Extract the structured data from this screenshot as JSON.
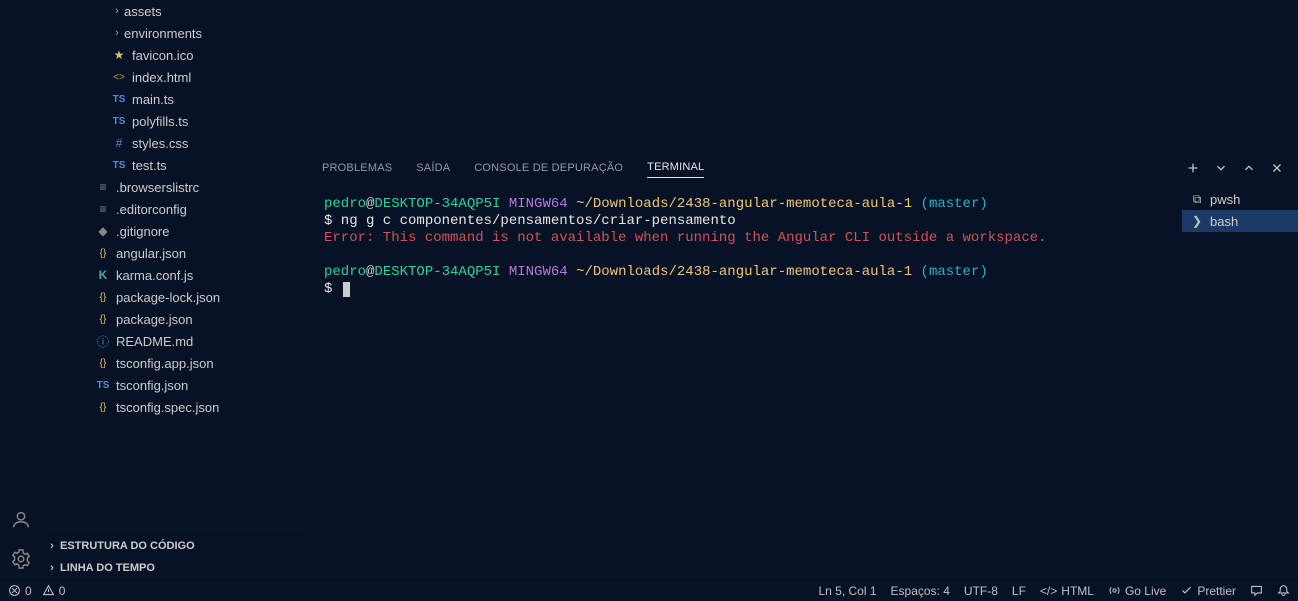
{
  "sidebar": {
    "tree": [
      {
        "kind": "folder",
        "icon": "chev",
        "label": "assets",
        "indent": "ind-1"
      },
      {
        "kind": "folder",
        "icon": "chev",
        "label": "environments",
        "indent": "ind-1"
      },
      {
        "kind": "file",
        "icon": "★",
        "iconClass": "c-yellow",
        "label": "favicon.ico",
        "indent": "ind-1"
      },
      {
        "kind": "file",
        "icon": "<>",
        "iconClass": "c-orange",
        "label": "index.html",
        "indent": "ind-1"
      },
      {
        "kind": "file",
        "icon": "TS",
        "iconClass": "c-blue",
        "label": "main.ts",
        "indent": "ind-1"
      },
      {
        "kind": "file",
        "icon": "TS",
        "iconClass": "c-blue",
        "label": "polyfills.ts",
        "indent": "ind-1"
      },
      {
        "kind": "file",
        "icon": "#",
        "iconClass": "c-blue",
        "label": "styles.css",
        "indent": "ind-1"
      },
      {
        "kind": "file",
        "icon": "TS",
        "iconClass": "c-blue",
        "label": "test.ts",
        "indent": "ind-1"
      },
      {
        "kind": "file",
        "icon": "≡",
        "iconClass": "c-gray",
        "label": ".browserslistrc",
        "indent": "ind-2"
      },
      {
        "kind": "file",
        "icon": "≡",
        "iconClass": "c-gray",
        "label": ".editorconfig",
        "indent": "ind-2"
      },
      {
        "kind": "file",
        "icon": "◆",
        "iconClass": "c-gray",
        "label": ".gitignore",
        "indent": "ind-2"
      },
      {
        "kind": "file",
        "icon": "{}",
        "iconClass": "c-yellow",
        "label": "angular.json",
        "indent": "ind-2"
      },
      {
        "kind": "file",
        "icon": "K",
        "iconClass": "c-teal",
        "label": "karma.conf.js",
        "indent": "ind-2"
      },
      {
        "kind": "file",
        "icon": "{}",
        "iconClass": "c-yellow",
        "label": "package-lock.json",
        "indent": "ind-2"
      },
      {
        "kind": "file",
        "icon": "{}",
        "iconClass": "c-yellow",
        "label": "package.json",
        "indent": "ind-2"
      },
      {
        "kind": "file",
        "icon": "ⓘ",
        "iconClass": "c-blue",
        "label": "README.md",
        "indent": "ind-2"
      },
      {
        "kind": "file",
        "icon": "{}",
        "iconClass": "c-yellow",
        "label": "tsconfig.app.json",
        "indent": "ind-2"
      },
      {
        "kind": "file",
        "icon": "TS",
        "iconClass": "c-blue",
        "label": "tsconfig.json",
        "indent": "ind-2"
      },
      {
        "kind": "file",
        "icon": "{}",
        "iconClass": "c-yellow",
        "label": "tsconfig.spec.json",
        "indent": "ind-2"
      }
    ],
    "sections": [
      {
        "label": "ESTRUTURA DO CÓDIGO"
      },
      {
        "label": "LINHA DO TEMPO"
      }
    ]
  },
  "panel": {
    "tabs": [
      "PROBLEMAS",
      "SAÍDA",
      "CONSOLE DE DEPURAÇÃO",
      "TERMINAL"
    ],
    "activeIndex": 3
  },
  "terminal": {
    "prompt1": {
      "user": "pedro",
      "at": "@",
      "host": "DESKTOP-34AQP5I",
      "env": " MINGW64 ",
      "path": "~/Downloads/2438-angular-memoteca-aula-1",
      "branch": " (master)"
    },
    "line1": "$ ng g c componentes/pensamentos/criar-pensamento",
    "error": "Error: This command is not available when running the Angular CLI outside a workspace.",
    "prompt2": {
      "user": "pedro",
      "at": "@",
      "host": "DESKTOP-34AQP5I",
      "env": " MINGW64 ",
      "path": "~/Downloads/2438-angular-memoteca-aula-1",
      "branch": " (master)"
    },
    "line2": "$ ",
    "sessions": [
      {
        "label": "pwsh",
        "active": false
      },
      {
        "label": "bash",
        "active": true
      }
    ]
  },
  "status": {
    "left": {
      "errors": "0",
      "warnings": "0"
    },
    "right": {
      "lncol": "Ln 5, Col 1",
      "spaces": "Espaços: 4",
      "encoding": "UTF-8",
      "eol": "LF",
      "language": "HTML",
      "golive": "Go Live",
      "prettier": "Prettier"
    }
  }
}
